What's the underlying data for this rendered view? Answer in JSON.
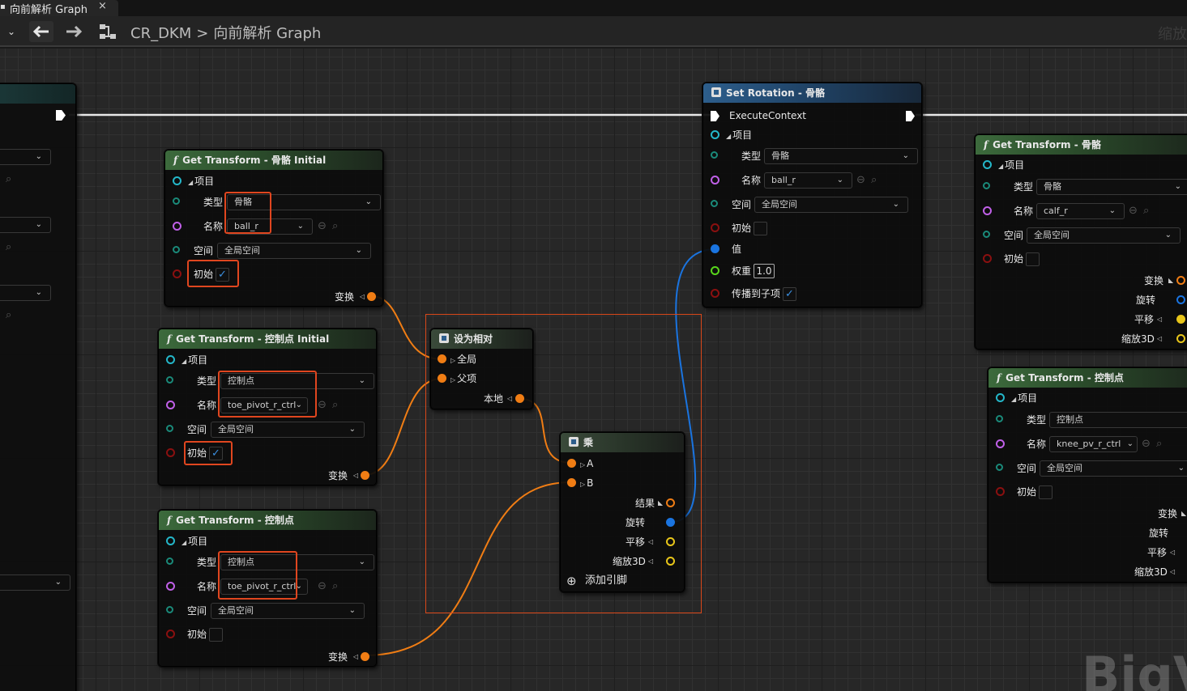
{
  "tab": {
    "title": "向前解析 Graph",
    "close": "×"
  },
  "toolbar": {
    "back_icon": "arrow-left-icon",
    "forward_icon": "arrow-right-icon",
    "graph_icon": "graph-icon",
    "breadcrumb_root": "CR_DKM",
    "breadcrumb_sep": ">",
    "breadcrumb_current": "向前解析 Graph",
    "zoom_hint": "缩放"
  },
  "common": {
    "items": "项目",
    "type": "类型",
    "name": "名称",
    "space": "空间",
    "initial": "初始",
    "transform": "变换",
    "rotation": "旋转",
    "translation": "平移",
    "scale3d": "缩放3D"
  },
  "node_gt_bone_initial": {
    "title": "Get Transform - 骨骼 Initial",
    "type_value": "骨骼",
    "name_value": "ball_r",
    "space_value": "全局空间",
    "initial_checked": "✓"
  },
  "node_gt_ctrl_initial": {
    "title": "Get Transform - 控制点 Initial",
    "type_value": "控制点",
    "name_value": "toe_pivot_r_ctrl",
    "space_value": "全局空间",
    "initial_checked": "✓"
  },
  "node_gt_ctrl": {
    "title": "Get Transform - 控制点",
    "type_value": "控制点",
    "name_value": "toe_pivot_r_ctrl",
    "space_value": "全局空间",
    "initial_checked": ""
  },
  "node_make_relative": {
    "title": "设为相对",
    "global": "全局",
    "parent": "父项",
    "local": "本地"
  },
  "node_multiply": {
    "title": "乘",
    "a": "A",
    "b": "B",
    "result": "结果",
    "rotation": "旋转",
    "translation": "平移",
    "scale3d": "缩放3D",
    "add_pin": "添加引脚"
  },
  "node_set_rotation": {
    "title": "Set Rotation - 骨骼",
    "execute": "ExecuteContext",
    "type_value": "骨骼",
    "name_value": "ball_r",
    "space_value": "全局空间",
    "initial_checked": "",
    "value": "值",
    "weight": "权重",
    "weight_value": "1.0",
    "propagate": "传播到子项",
    "propagate_checked": "✓"
  },
  "node_gt_bone_right": {
    "title": "Get Transform - 骨骼",
    "type_value": "骨骼",
    "name_value": "calf_r",
    "space_value": "全局空间"
  },
  "node_gt_ctrl_right": {
    "title": "Get Transform - 控制点",
    "type_value": "控制点",
    "name_value": "knee_pv_r_ctrl",
    "space_value": "全局空间"
  },
  "watermark": "BigVI",
  "colors": {
    "transform_pin": "#f07d14",
    "rotation_pin": "#1a74e0",
    "vector_pin": "#e8c61a",
    "item_pin": "#24b7c9",
    "name_pin": "#c060e8",
    "space_pin": "#1a8a7a",
    "bool_pin": "#8a1010",
    "float_pin": "#58d61c",
    "highlight": "#e0461f"
  }
}
